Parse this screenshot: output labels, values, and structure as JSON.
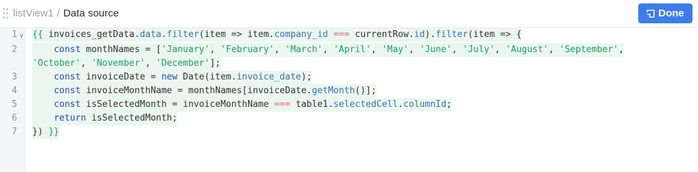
{
  "header": {
    "breadcrumb_parent": "listView1",
    "breadcrumb_separator": "/",
    "breadcrumb_current": "Data source",
    "done_label": "Done",
    "done_color": "#3d7de8"
  },
  "gutter": {
    "line_numbers": [
      "1",
      "2",
      "3",
      "4",
      "5",
      "6",
      "7"
    ]
  },
  "code": {
    "l1": {
      "t1": "{{",
      "t2": " invoices_getData.",
      "t3": "data",
      "t4": ".",
      "t5": "filter",
      "t6": "(item => item.",
      "t7": "company_id",
      "t8": " ",
      "t9": "===",
      "t10": " currentRow.",
      "t11": "id",
      "t12": ").",
      "t13": "filter",
      "t14": "(item => {"
    },
    "l2": {
      "t1": "    ",
      "t2": "const",
      "t3": " monthNames = [",
      "t4": "'January'",
      "t5": ", ",
      "t6": "'February'",
      "t7": ", ",
      "t8": "'March'",
      "t9": ", ",
      "t10": "'April'",
      "t11": ", ",
      "t12": "'May'",
      "t13": ", ",
      "t14": "'June'",
      "t15": ", ",
      "t16": "'July'",
      "t17": ", ",
      "t18": "'August'",
      "t19": ", ",
      "t20": "'September'",
      "t21": ","
    },
    "l2b": {
      "t1": "'October'",
      "t2": ", ",
      "t3": "'November'",
      "t4": ", ",
      "t5": "'December'",
      "t6": "];"
    },
    "l3": {
      "t1": "    ",
      "t2": "const",
      "t3": " invoiceDate = ",
      "t4": "new",
      "t5": " Date(item.",
      "t6": "invoice_date",
      "t7": ");"
    },
    "l4": {
      "t1": "    ",
      "t2": "const",
      "t3": " invoiceMonthName = monthNames[invoiceDate.",
      "t4": "getMonth",
      "t5": "()];"
    },
    "l5": {
      "t1": "    ",
      "t2": "const",
      "t3": " isSelectedMonth = invoiceMonthName ",
      "t4": "===",
      "t5": " table1.",
      "t6": "selectedCell",
      "t7": ".",
      "t8": "columnId",
      "t9": ";"
    },
    "l6": {
      "t1": "    ",
      "t2": "return",
      "t3": " isSelectedMonth;"
    },
    "l7": {
      "t1": "}) ",
      "t2": "}}"
    }
  }
}
